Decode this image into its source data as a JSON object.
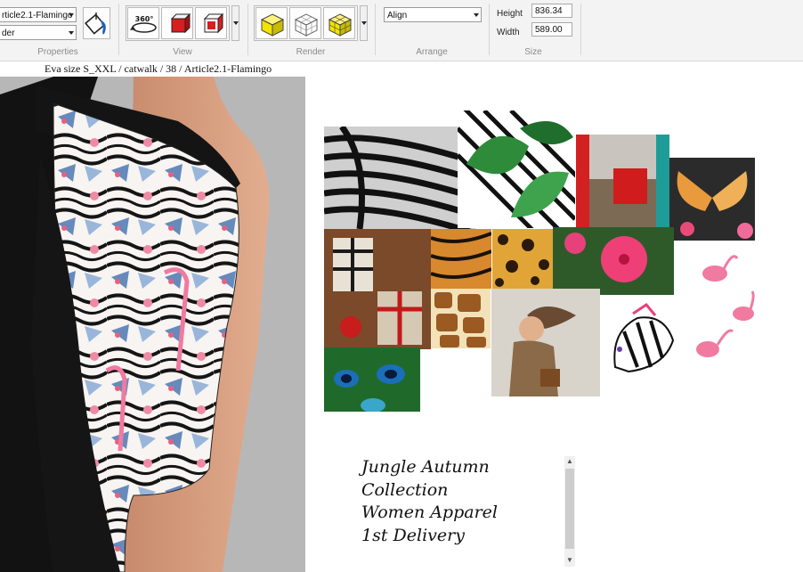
{
  "ribbon": {
    "properties": {
      "article_combo": "rticle2.1-Flamingo",
      "render_combo": "der",
      "label": "Properties"
    },
    "view": {
      "label": "View"
    },
    "render": {
      "label": "Render"
    },
    "arrange": {
      "align_combo": "Align",
      "label": "Arrange"
    },
    "size": {
      "height_label": "Height",
      "height_value": "836.34",
      "width_label": "Width",
      "width_value": "589.00",
      "label": "Size"
    },
    "icons": {
      "rotate_360": "360°"
    }
  },
  "breadcrumb": "Eva size S_XXL / catwalk / 38 / Article2.1-Flamingo",
  "caption": {
    "line1": "Jungle Autumn",
    "line2": "Collection",
    "line3": "Women Apparel",
    "line4": "1st Delivery"
  },
  "colors": {
    "ribbon_bg": "#f3f3f3",
    "cube_red": "#d81e1e",
    "cube_yellow": "#f2e300",
    "viewport_bg": "#b7b7b7",
    "flamingo_pink": "#f07aa0"
  },
  "icon_names": [
    "paint-bucket-icon",
    "rotate-360-icon",
    "red-cube-solid-icon",
    "red-cube-wire-icon",
    "yellow-cube-solid-icon",
    "wireframe-cube-icon",
    "yellow-cube-grid-icon",
    "dropdown-arrow-icon"
  ]
}
